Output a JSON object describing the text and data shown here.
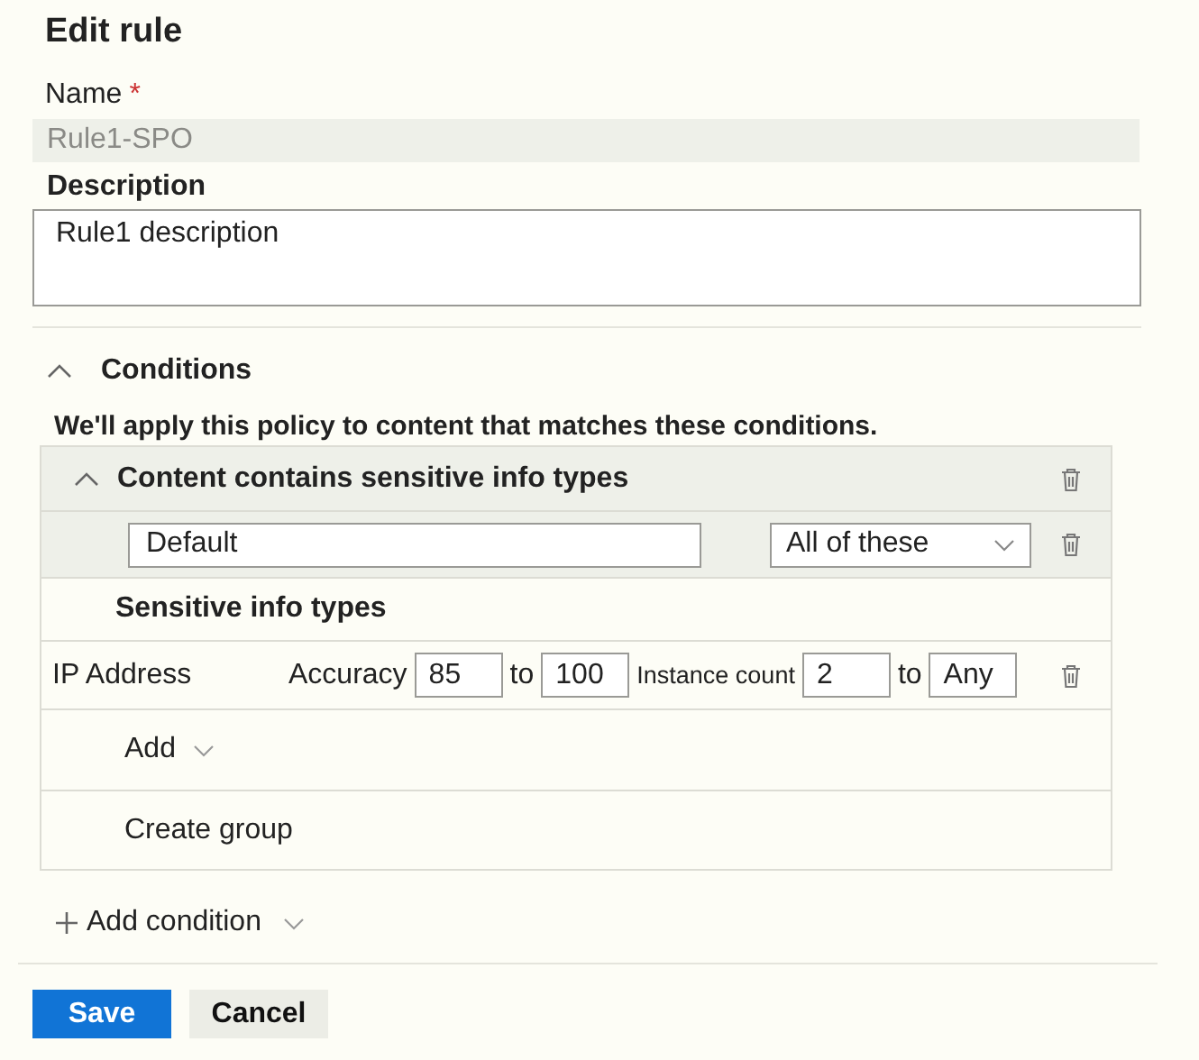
{
  "title": "Edit rule",
  "name_field": {
    "label": "Name",
    "required_mark": "*",
    "value": "Rule1-SPO",
    "disabled": true
  },
  "description_field": {
    "label": "Description",
    "value": "Rule1 description"
  },
  "conditions": {
    "label": "Conditions",
    "expanded": true,
    "intro": "We'll apply this policy to content that matches these conditions.",
    "group": {
      "title": "Content contains sensitive info types",
      "expanded": true,
      "name_value": "Default",
      "match_value": "All of these",
      "section_title": "Sensitive info types",
      "items": [
        {
          "name": "IP Address",
          "accuracy_label": "Accuracy",
          "accuracy_min": "85",
          "to_1": "to",
          "accuracy_max": "100",
          "count_label": "Instance count",
          "count_min": "2",
          "to_2": "to",
          "count_max": "Any"
        }
      ],
      "add_label": "Add",
      "create_group_label": "Create group"
    },
    "add_condition_label": "Add condition"
  },
  "buttons": {
    "save": "Save",
    "cancel": "Cancel"
  }
}
